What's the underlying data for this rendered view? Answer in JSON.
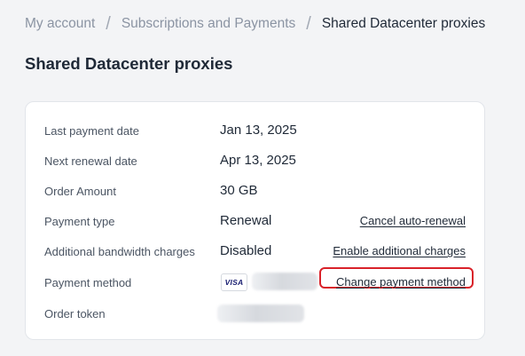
{
  "breadcrumb": {
    "items": [
      "My account",
      "Subscriptions and Payments"
    ],
    "separator": "/",
    "current": "Shared Datacenter proxies"
  },
  "page": {
    "title": "Shared Datacenter proxies"
  },
  "details": {
    "last_payment": {
      "label": "Last payment date",
      "value": "Jan 13, 2025"
    },
    "next_renewal": {
      "label": "Next renewal date",
      "value": "Apr 13, 2025"
    },
    "order_amount": {
      "label": "Order Amount",
      "value": "30 GB"
    },
    "payment_type": {
      "label": "Payment type",
      "value": "Renewal",
      "action": "Cancel auto-renewal"
    },
    "additional_charges": {
      "label": "Additional bandwidth charges",
      "value": "Disabled",
      "action": "Enable additional charges"
    },
    "payment_method": {
      "label": "Payment method",
      "card_brand": "VISA",
      "action": "Change payment method"
    },
    "order_token": {
      "label": "Order token"
    }
  },
  "colors": {
    "highlight": "#d9222a",
    "visa_text": "#1a1f71",
    "background": "#f3f4f6",
    "card": "#ffffff"
  }
}
